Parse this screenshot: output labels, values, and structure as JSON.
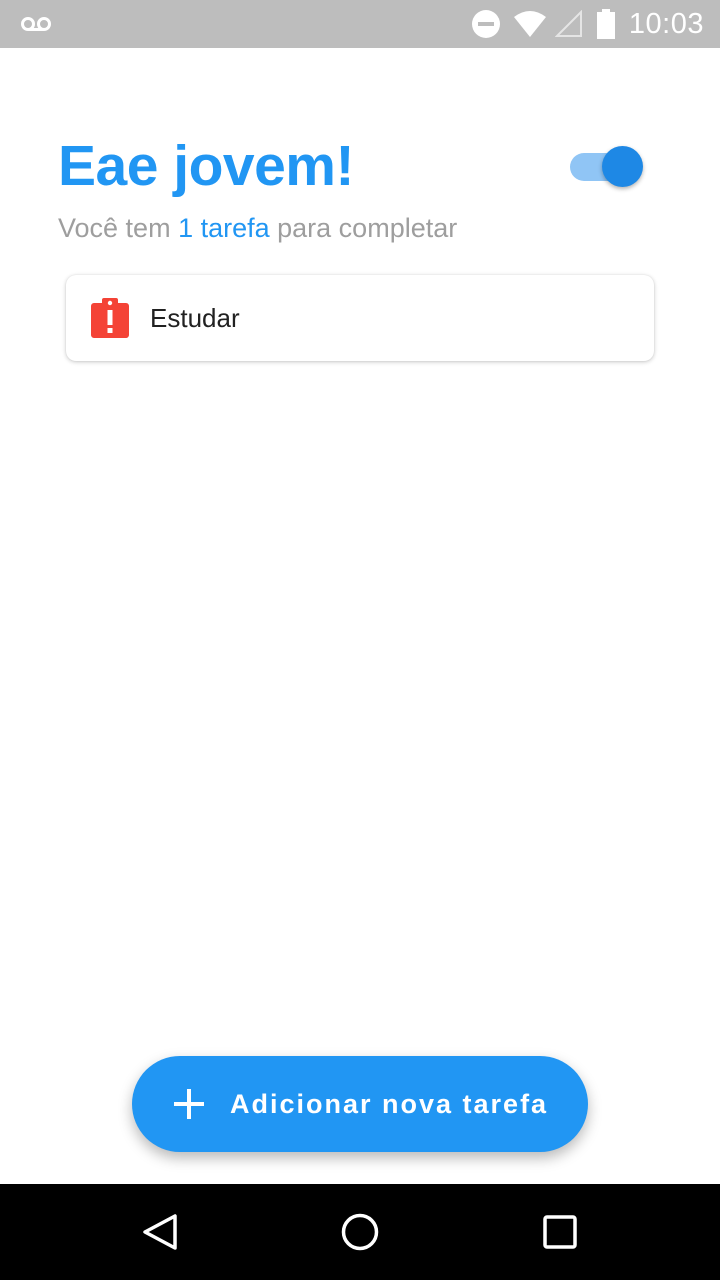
{
  "status_bar": {
    "time": "10:03",
    "icons": [
      "voicemail-icon",
      "do-not-disturb-icon",
      "wifi-icon",
      "signal-icon",
      "battery-icon"
    ]
  },
  "header": {
    "greeting": "Eae jovem!",
    "subtitle_prefix": "Você tem ",
    "task_count_text": "1 tarefa",
    "subtitle_suffix": " para completar",
    "toggle_on": true
  },
  "tasks": [
    {
      "label": "Estudar",
      "icon": "clipboard-alert-icon",
      "icon_color": "#f44336"
    }
  ],
  "fab": {
    "label": "Adicionar nova tarefa",
    "icon": "plus-icon"
  },
  "nav_bar": {
    "buttons": [
      "back-icon",
      "home-icon",
      "recents-icon"
    ]
  },
  "colors": {
    "accent": "#2196f3",
    "toggle_track": "#90c5f5",
    "toggle_thumb": "#1e88e5",
    "subtitle_gray": "#9e9e9e",
    "status_bar": "#bdbdbd",
    "alert_red": "#f44336"
  }
}
